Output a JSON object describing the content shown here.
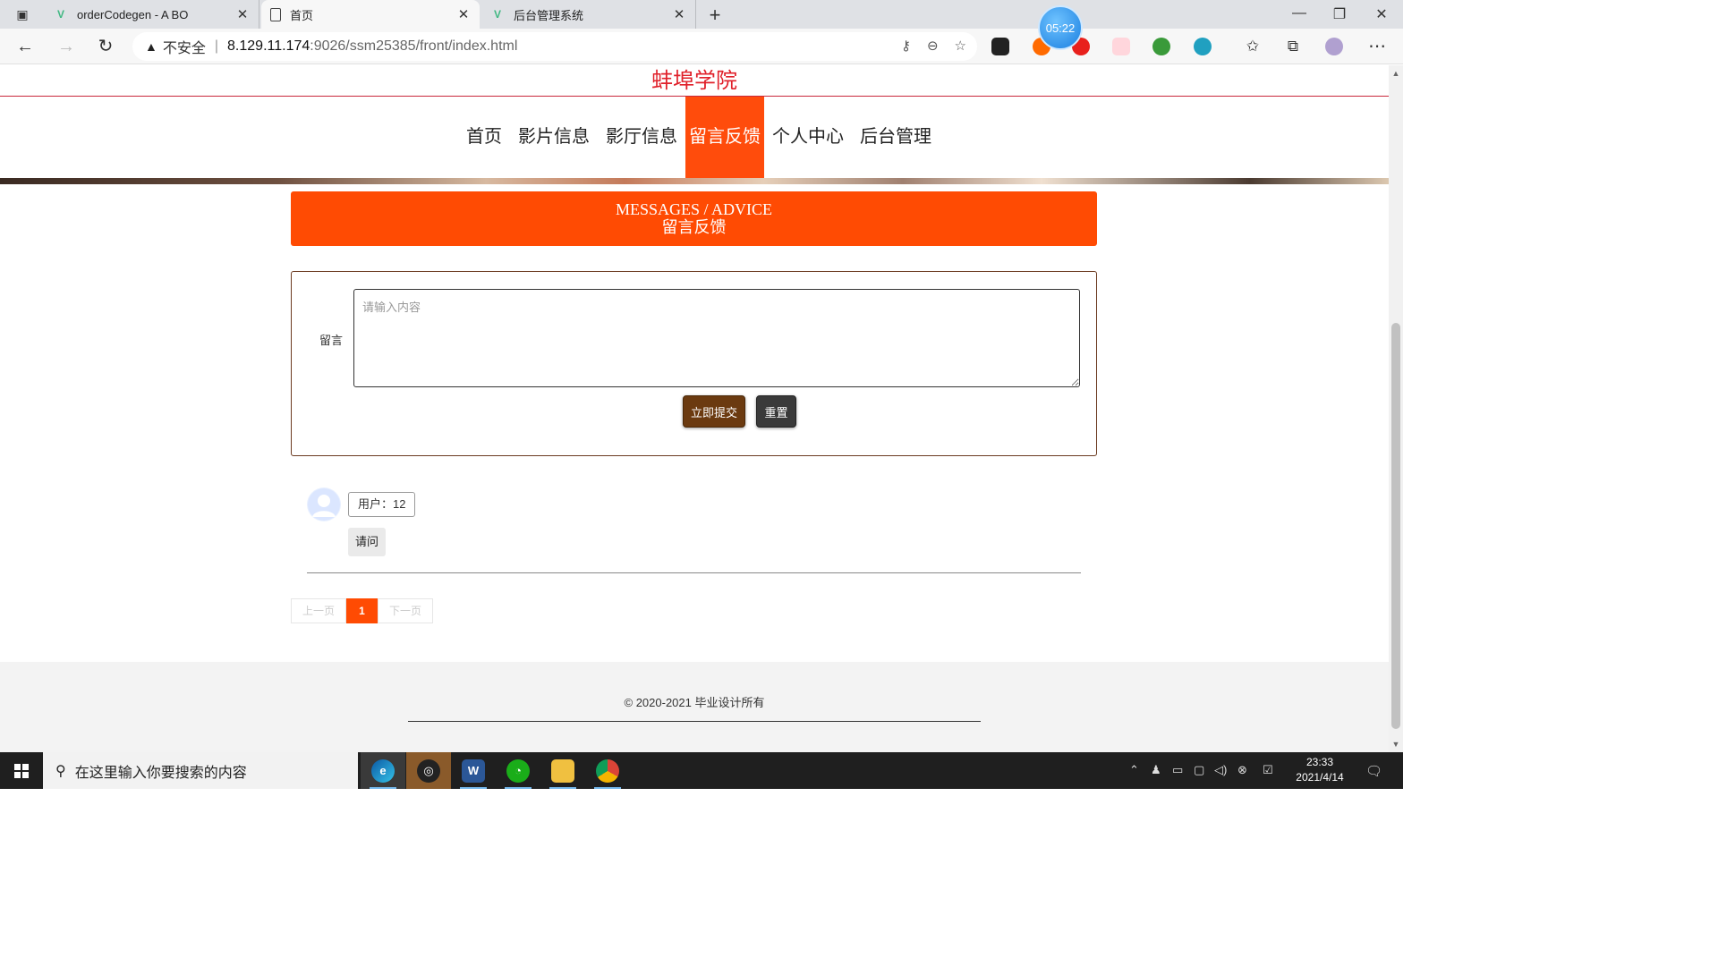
{
  "browser": {
    "tabs": [
      {
        "title": "orderCodegen - A BO",
        "icon": "vue-icon"
      },
      {
        "title": "首页",
        "icon": "page-icon"
      },
      {
        "title": "后台管理系统",
        "icon": "vue-icon"
      }
    ],
    "timer": "05:22",
    "address": {
      "security_label": "不安全",
      "host": "8.129.11.174",
      "path": ":9026/ssm25385/front/index.html"
    }
  },
  "site": {
    "title": "蚌埠学院",
    "nav": [
      "首页",
      "影片信息",
      "影厅信息",
      "留言反馈",
      "个人中心",
      "后台管理"
    ],
    "active_nav_index": 3,
    "accent_color": "#ff4b03"
  },
  "section": {
    "title_en": "MESSAGES / ADVICE",
    "title_cn": "留言反馈"
  },
  "form": {
    "label": "留言",
    "placeholder": "请输入内容",
    "submit_label": "立即提交",
    "reset_label": "重置"
  },
  "messages": [
    {
      "user": "用户：12",
      "content": "请问"
    }
  ],
  "pager": {
    "prev": "上一页",
    "current": "1",
    "next": "下一页"
  },
  "footer": {
    "copyright": "© 2020-2021 毕业设计所有"
  },
  "taskbar": {
    "search_placeholder": "在这里输入你要搜索的内容",
    "time": "23:33",
    "date": "2021/4/14"
  }
}
